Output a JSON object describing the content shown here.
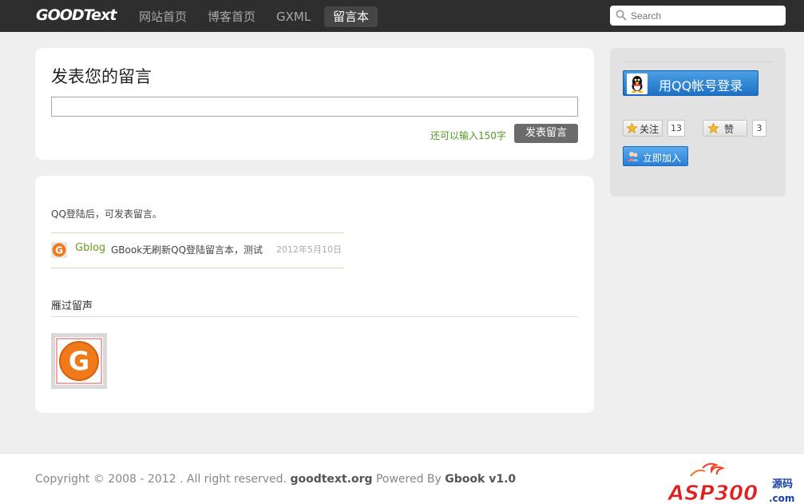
{
  "nav": {
    "logo": "GOODText",
    "items": [
      {
        "label": "网站首页",
        "active": false
      },
      {
        "label": "博客首页",
        "active": false
      },
      {
        "label": "GXML",
        "active": false
      },
      {
        "label": "留言本",
        "active": true
      }
    ],
    "search_placeholder": "Search"
  },
  "post": {
    "title": "发表您的留言",
    "input_value": "",
    "remaining": "还可以输入150字",
    "submit_label": "发表留言"
  },
  "messages": {
    "login_hint": "QQ登陆后，可发表留言。",
    "items": [
      {
        "user": "Gblog",
        "text": "GBook无刷新QQ登陆留言本，测试",
        "date": "2012年5月10日"
      }
    ],
    "visitors_title": "雁过留声"
  },
  "sidebar": {
    "qq_login_label": "用QQ帐号登录",
    "follow_label": "关注",
    "follow_count": "13",
    "like_label": "赞",
    "like_count": "3",
    "join_label": "立即加入"
  },
  "footer": {
    "copyright_prefix": "Copyright © 2008 - 2012 . All right reserved. ",
    "site": "goodtext.org",
    "powered_prefix": " Powered By ",
    "product": "Gbook v1.0",
    "badge": "ASP300源码",
    "badge_domain": ".com"
  },
  "colors": {
    "topbar": "#2e2e2e",
    "accent_green": "#4f9a1d",
    "qq_blue": "#1e72c8"
  }
}
